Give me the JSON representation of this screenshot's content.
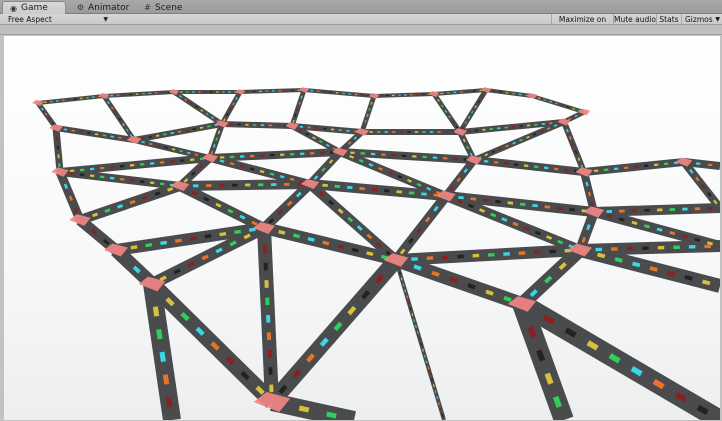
{
  "tabs": [
    {
      "label": "Game",
      "icon": "game-controller-icon"
    },
    {
      "label": "Animator",
      "icon": "animator-icon"
    },
    {
      "label": "Scene",
      "icon": "scene-grid-icon"
    }
  ],
  "toolbar": {
    "aspect_label": "Free Aspect",
    "maximize_label": "Maximize on Play",
    "mute_label": "Mute audio",
    "stats_label": "Stats",
    "gizmos_label": "Gizmos"
  },
  "scene": {
    "road_color": "#4a4b4c",
    "node_color": "#f08585",
    "dash_colors": [
      "#2fd05a",
      "#39d8e8",
      "#e8742a",
      "#8a2020",
      "#222222",
      "#d6c23a"
    ]
  }
}
